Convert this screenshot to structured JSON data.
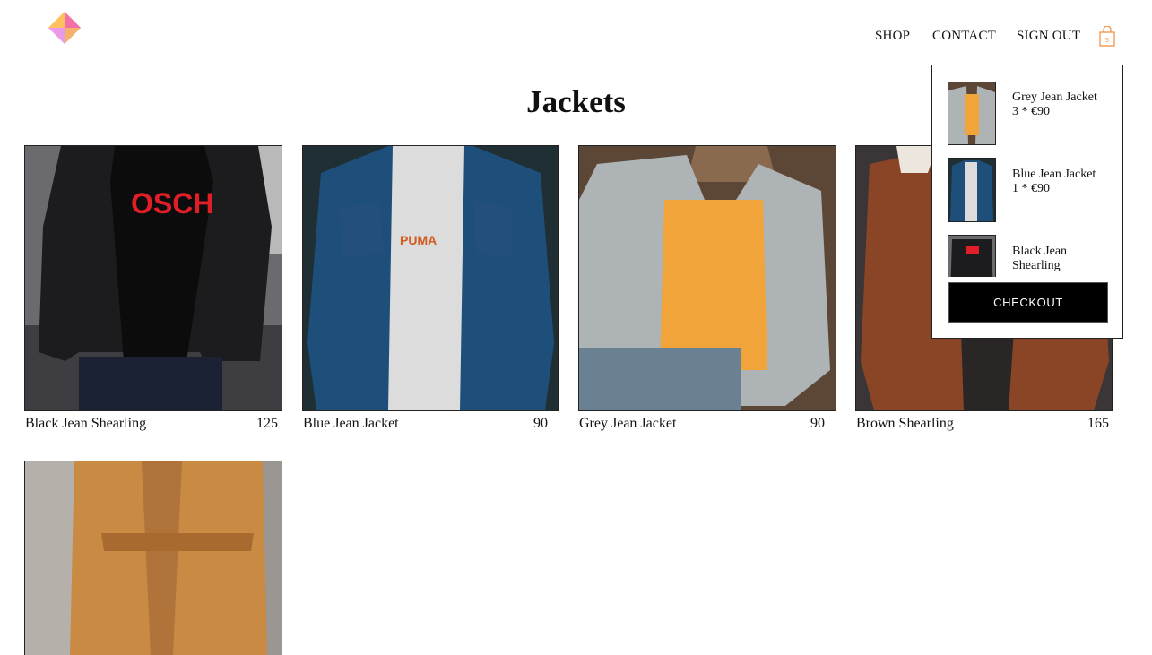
{
  "header": {
    "logo_icon": "diamond-logo-icon",
    "nav": [
      {
        "label": "SHOP"
      },
      {
        "label": "CONTACT"
      },
      {
        "label": "SIGN OUT"
      }
    ],
    "cart_icon": "shopping-bag-icon"
  },
  "page": {
    "title": "Jackets"
  },
  "products": [
    {
      "name": "Black Jean Shearling",
      "price": "125"
    },
    {
      "name": "Blue Jean Jacket",
      "price": "90"
    },
    {
      "name": "Grey Jean Jacket",
      "price": "90"
    },
    {
      "name": "Brown Shearling",
      "price": "165"
    },
    {
      "name": "",
      "price": ""
    }
  ],
  "cart_dropdown": {
    "items": [
      {
        "name": "Grey Jean Jacket",
        "qty_price": "3 * €90"
      },
      {
        "name": "Blue Jean Jacket",
        "qty_price": "1 * €90"
      },
      {
        "name": "Black Jean Shearling",
        "qty_price": ""
      }
    ],
    "checkout_label": "CHECKOUT"
  },
  "colors": {
    "accent": "#f28c3a",
    "checkout_bg": "#000000",
    "text": "#111111"
  }
}
